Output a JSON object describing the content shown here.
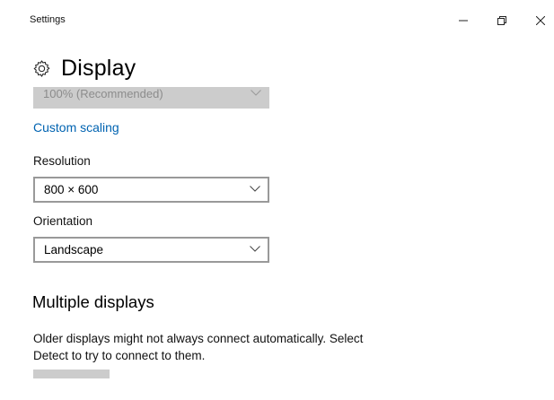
{
  "window": {
    "title": "Settings",
    "controls": {
      "minimize_icon": "minimize-icon",
      "maximize_icon": "restore-icon",
      "close_icon": "close-icon"
    }
  },
  "page": {
    "icon": "gear-icon",
    "title": "Display"
  },
  "scale": {
    "selected": "100% (Recommended)"
  },
  "custom_scaling": {
    "label": "Custom scaling"
  },
  "resolution": {
    "label": "Resolution",
    "selected": "800 × 600"
  },
  "orientation": {
    "label": "Orientation",
    "selected": "Landscape"
  },
  "multiple_displays": {
    "heading": "Multiple displays",
    "description_line1": "Older displays might not always connect automatically. Select",
    "description_line2": "Detect to try to connect to them."
  },
  "colors": {
    "accent": "#0063b1",
    "disabled_bg": "#cccccc",
    "border": "#999999"
  }
}
